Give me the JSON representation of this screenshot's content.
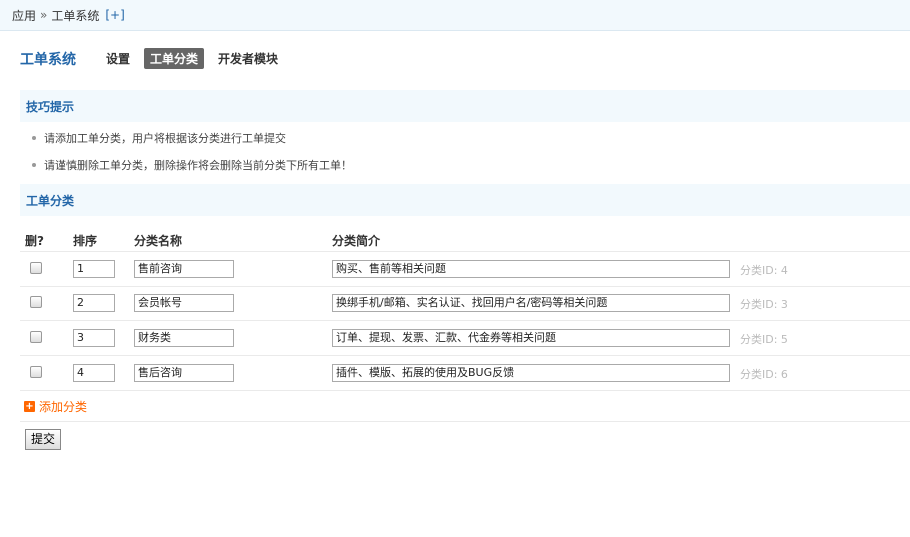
{
  "breadcrumb": {
    "root": "应用",
    "separator": "»",
    "current": "工单系统",
    "add": "[+]"
  },
  "header": {
    "title": "工单系统",
    "nav": [
      "设置",
      "工单分类",
      "开发者模块"
    ]
  },
  "tips": {
    "title": "技巧提示",
    "items": [
      "请添加工单分类，用户将根据该分类进行工单提交",
      "请谨慎删除工单分类，删除操作将会删除当前分类下所有工单！"
    ]
  },
  "category_section": {
    "title": "工单分类"
  },
  "table": {
    "headers": {
      "delete": "删?",
      "order": "排序",
      "name": "分类名称",
      "desc": "分类简介"
    },
    "rows": [
      {
        "order": "1",
        "name": "售前咨询",
        "desc": "购买、售前等相关问题",
        "fid": "分类ID: 4"
      },
      {
        "order": "2",
        "name": "会员帐号",
        "desc": "换绑手机/邮箱、实名认证、找回用户名/密码等相关问题",
        "fid": "分类ID: 3"
      },
      {
        "order": "3",
        "name": "财务类",
        "desc": "订单、提现、发票、汇款、代金券等相关问题",
        "fid": "分类ID: 5"
      },
      {
        "order": "4",
        "name": "售后咨询",
        "desc": "插件、模版、拓展的使用及BUG反馈",
        "fid": "分类ID: 6"
      }
    ]
  },
  "actions": {
    "add_category": "添加分类",
    "submit": "提交"
  }
}
